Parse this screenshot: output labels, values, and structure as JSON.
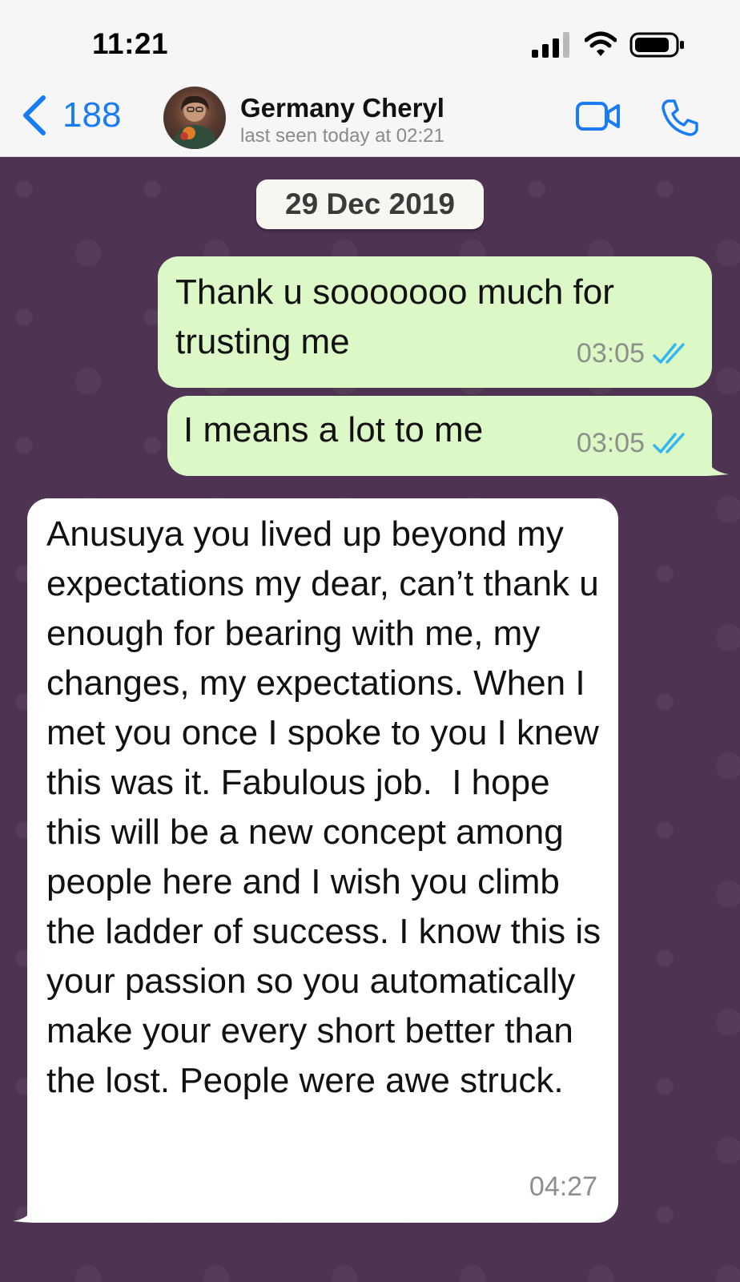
{
  "status_bar": {
    "time": "11:21"
  },
  "header": {
    "back_count": "188",
    "contact_name": "Germany Cheryl",
    "last_seen": "last seen today at 02:21"
  },
  "chat": {
    "date_chip": "29 Dec 2019",
    "messages": [
      {
        "direction": "outgoing",
        "text": "Thank u sooooooo much for trusting me",
        "time": "03:05",
        "status": "read"
      },
      {
        "direction": "outgoing",
        "text": "I means a lot to me",
        "time": "03:05",
        "status": "read"
      },
      {
        "direction": "incoming",
        "text": "Anusuya you lived up beyond my expectations my dear, can’t thank u enough for bearing with me, my changes, my expectations. When I met you once I spoke to you I knew this was it. Fabulous job.  I hope this will be a new concept among people here and I wish you climb the ladder of success. I know this is your passion so you automatically make your every short better than the lost. People were awe struck.",
        "time": "04:27"
      }
    ]
  },
  "colors": {
    "accent": "#1a7cf5",
    "outgoing_bubble": "#dcf8c6",
    "incoming_bubble": "#ffffff",
    "chat_background": "#4e3452",
    "read_ticks": "#34b7f1"
  },
  "icons": [
    "back-chevron-icon",
    "video-call-icon",
    "phone-icon",
    "cellular-signal-icon",
    "wifi-icon",
    "battery-icon",
    "double-check-icon"
  ]
}
